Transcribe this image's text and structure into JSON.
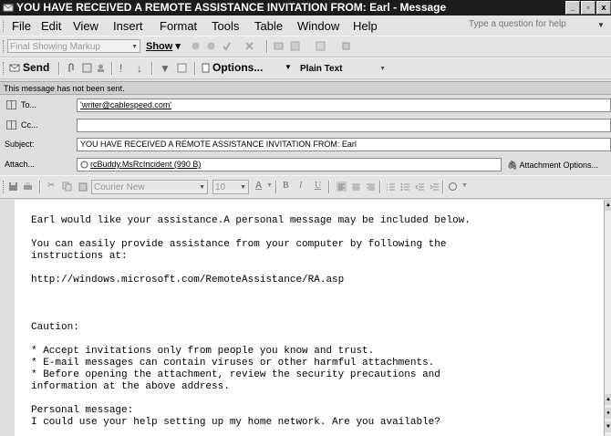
{
  "window": {
    "title": "YOU HAVE RECEIVED A REMOTE ASSISTANCE INVITATION FROM: Earl - Message",
    "buttons": {
      "minimize": "_",
      "restore": "▫",
      "close": "x"
    }
  },
  "menu": {
    "items": [
      "File",
      "Edit",
      "View",
      "Insert",
      "Format",
      "Tools",
      "Table",
      "Window",
      "Help"
    ],
    "help_search_placeholder": "Type a question for help"
  },
  "review_toolbar": {
    "markup_select": "Final Showing Markup",
    "show_label": "Show"
  },
  "send_toolbar": {
    "send_label": "Send",
    "options_label": "Options...",
    "format_select": "Plain Text"
  },
  "info_bar": "This message has not been sent.",
  "header": {
    "to_label": "To...",
    "to_value": "'writer@cablespeed.com'",
    "cc_label": "Cc...",
    "cc_value": "",
    "subject_label": "Subject:",
    "subject_value": "YOU HAVE RECEIVED A REMOTE ASSISTANCE INVITATION FROM: Earl",
    "attach_label": "Attach...",
    "attach_value": "rcBuddy.MsRcIncident (990 B)",
    "attachment_options_label": "Attachment Options..."
  },
  "format_toolbar": {
    "font": "Courier New",
    "size": "10",
    "bold": "B",
    "italic": "I",
    "underline": "U"
  },
  "message_lines": [
    "Earl would like your assistance.A personal message may be included below.",
    "",
    "You can easily provide assistance from your computer by following the",
    "instructions at:",
    "",
    "http://windows.microsoft.com/RemoteAssistance/RA.asp",
    "",
    "",
    "Caution:",
    "",
    "* Accept invitations only from people you know and trust.",
    "* E-mail messages can contain viruses or other harmful attachments.",
    "* Before opening the attachment, review the security precautions and",
    "information at the above address.",
    "",
    "Personal message:",
    "I could use your help setting up my home network. Are you available?"
  ]
}
